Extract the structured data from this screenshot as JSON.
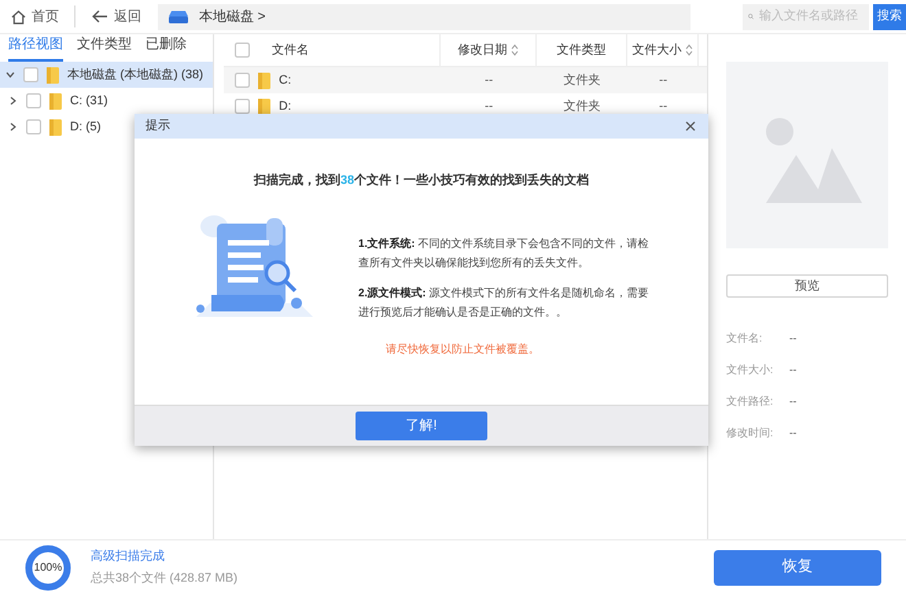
{
  "nav": {
    "home": "首页",
    "back": "返回",
    "breadcrumb": "本地磁盘 >"
  },
  "search": {
    "placeholder": "输入文件名或路径",
    "button": "搜索"
  },
  "tabs": [
    {
      "label": "路径视图",
      "selected": true
    },
    {
      "label": "文件类型",
      "selected": false
    },
    {
      "label": "已删除",
      "selected": false
    }
  ],
  "tree": [
    {
      "label": "本地磁盘 (本地磁盘) (38)",
      "expanded": true,
      "selected": true,
      "checked": false,
      "children": [
        {
          "label": "C: (31)",
          "expanded": false,
          "selected": false,
          "checked": false
        },
        {
          "label": "D: (5)",
          "expanded": false,
          "selected": false,
          "checked": false
        }
      ]
    }
  ],
  "table": {
    "all_checked": false,
    "columns": [
      {
        "label": "文件名",
        "sortable": false
      },
      {
        "label": "修改日期",
        "sortable": true
      },
      {
        "label": "文件类型",
        "sortable": false
      },
      {
        "label": "文件大小",
        "sortable": true
      }
    ],
    "rows": [
      {
        "name": "C:",
        "date": "--",
        "type": "文件夹",
        "size": "--",
        "checked": false
      },
      {
        "name": "D:",
        "date": "--",
        "type": "文件夹",
        "size": "--",
        "checked": false
      }
    ]
  },
  "preview": {
    "button": "预览",
    "fields": [
      {
        "label": "文件名:",
        "value": "--"
      },
      {
        "label": "文件大小:",
        "value": "--"
      },
      {
        "label": "文件路径:",
        "value": "--"
      },
      {
        "label": "修改时间:",
        "value": "--"
      }
    ]
  },
  "dialog": {
    "title": "提示",
    "headline_start": "扫描完成，找到",
    "headline_count": "38",
    "headline_end": "个文件！一些小技巧有效的找到丢失的文档",
    "tips": [
      {
        "title": "1.文件系统:",
        "text": "不同的文件系统目录下会包含不同的文件，请检查所有文件夹以确保能找到您所有的丢失文件。"
      },
      {
        "title": "2.源文件模式:",
        "text": "源文件模式下的所有文件名是随机命名，需要进行预览后才能确认是否是正确的文件。。"
      }
    ],
    "warning": "请尽快恢复以防止文件被覆盖。",
    "button": "了解!"
  },
  "status": {
    "level": 1,
    "percent": "100%",
    "title": "高级扫描完成",
    "summary": "总共38个文件 (428.87 MB)",
    "button": "恢复"
  }
}
